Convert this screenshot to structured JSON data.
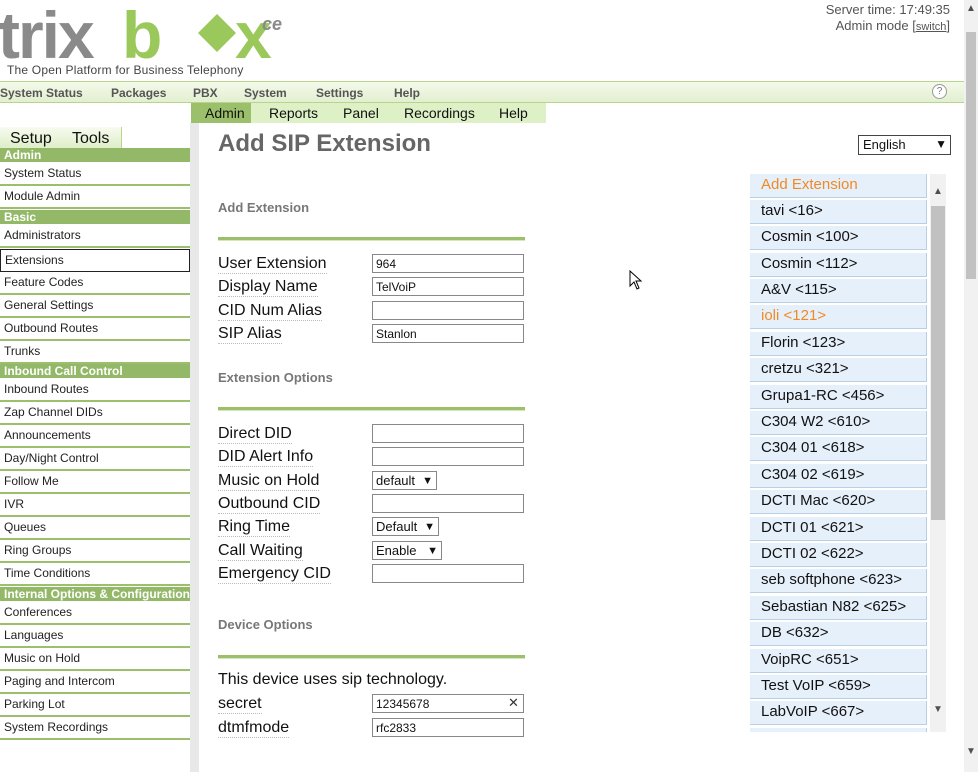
{
  "header": {
    "logo_text": "trixbox",
    "logo_edition": "ce",
    "tagline": "The Open Platform for Business Telephony",
    "server_time": "Server time: 17:49:35",
    "admin_mode_prefix": "Admin mode [",
    "admin_mode_link": "switch",
    "admin_mode_suffix": "]"
  },
  "topnav": {
    "items": [
      "System Status",
      "Packages",
      "PBX",
      "System",
      "Settings",
      "Help"
    ],
    "help_icon": "?"
  },
  "subtabs": [
    "Admin",
    "Reports",
    "Panel",
    "Recordings",
    "Help"
  ],
  "sidebar": {
    "tabs": [
      "Setup",
      "Tools"
    ],
    "sections": {
      "admin": "Admin",
      "basic": "Basic",
      "inbound": "Inbound Call Control",
      "internal": "Internal Options & Configuration"
    },
    "items": [
      "System Status",
      "Module Admin",
      "Administrators",
      "Extensions",
      "Feature Codes",
      "General Settings",
      "Outbound Routes",
      "Trunks",
      "Inbound Routes",
      "Zap Channel DIDs",
      "Announcements",
      "Day/Night Control",
      "Follow Me",
      "IVR",
      "Queues",
      "Ring Groups",
      "Time Conditions",
      "Conferences",
      "Languages",
      "Music on Hold",
      "Paging and Intercom",
      "Parking Lot",
      "System Recordings"
    ]
  },
  "main": {
    "title": "Add SIP Extension",
    "language": "English",
    "sections": {
      "add_extension": "Add Extension",
      "extension_options": "Extension Options",
      "device_options": "Device Options"
    },
    "fields": {
      "user_extension": {
        "label": "User Extension",
        "value": "964"
      },
      "display_name": {
        "label": "Display Name",
        "value": "TelVoiP"
      },
      "cid_num_alias": {
        "label": "CID Num Alias",
        "value": ""
      },
      "sip_alias": {
        "label": "SIP Alias",
        "value": "Stanlon"
      },
      "direct_did": {
        "label": "Direct DID",
        "value": ""
      },
      "did_alert_info": {
        "label": "DID Alert Info",
        "value": ""
      },
      "music_on_hold": {
        "label": "Music on Hold",
        "value": "default"
      },
      "outbound_cid": {
        "label": "Outbound CID",
        "value": ""
      },
      "ring_time": {
        "label": "Ring Time",
        "value": "Default"
      },
      "call_waiting": {
        "label": "Call Waiting",
        "value": "Enable"
      },
      "emergency_cid": {
        "label": "Emergency CID",
        "value": ""
      },
      "secret": {
        "label": "secret",
        "value": "12345678"
      },
      "dtmfmode": {
        "label": "dtmfmode",
        "value": "rfc2833"
      }
    },
    "device_note": "This device uses sip technology.",
    "clear_icon": "✕"
  },
  "extensions": [
    "Add Extension",
    "tavi <16>",
    "Cosmin <100>",
    "Cosmin <112>",
    "A&V <115>",
    "ioli <121>",
    "Florin <123>",
    "cretzu <321>",
    "Grupa1-RC <456>",
    "C304 W2 <610>",
    "C304 01 <618>",
    "C304 02 <619>",
    "DCTI Mac <620>",
    "DCTI 01 <621>",
    "DCTI 02 <622>",
    "seb softphone <623>",
    "Sebastian N82 <625>",
    "DB <632>",
    "VoipRC <651>",
    "Test VoIP <659>",
    "LabVoIP <667>"
  ],
  "colors": {
    "accent_green": "#9bbf6a",
    "highlight_orange": "#f08a24",
    "logo_gray": "#888888",
    "logo_green": "#9bc85a"
  }
}
